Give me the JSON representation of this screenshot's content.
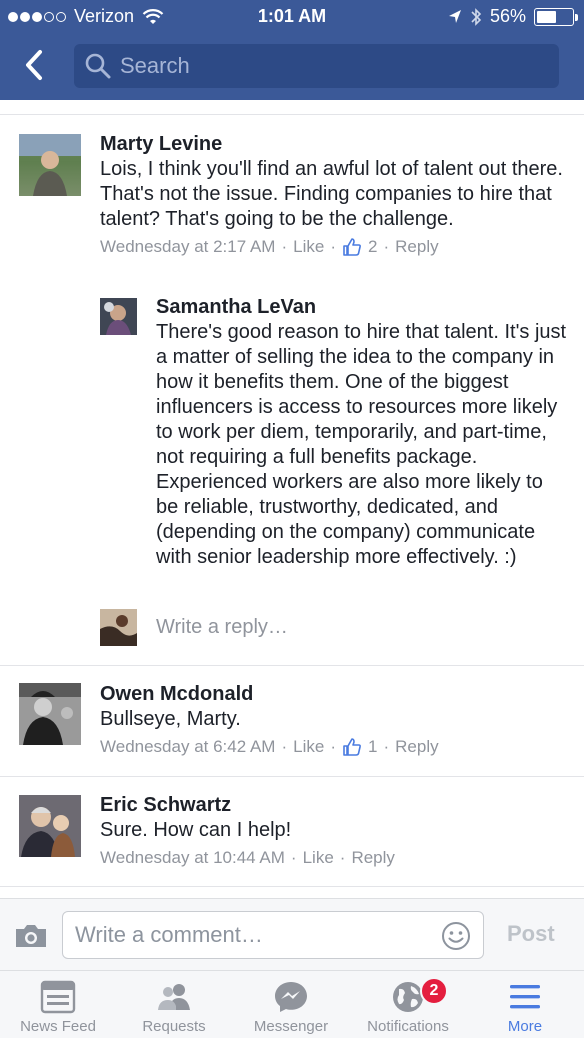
{
  "status_bar": {
    "carrier": "Verizon",
    "time": "1:01 AM",
    "battery": "56%",
    "battery_level": 0.56
  },
  "nav": {
    "search_placeholder": "Search"
  },
  "colors": {
    "brand": "#3b5998",
    "link": "#4a7be0",
    "meta": "#90949c",
    "badge": "#e41e3f"
  },
  "comments": [
    {
      "author": "Marty Levine",
      "text": "Lois, I think you'll find an awful lot of talent out there. That's not the issue. Finding companies to hire that talent? That's going to be the challenge.",
      "time": "Wednesday at 2:17 AM",
      "like_label": "Like",
      "like_count": "2",
      "reply_label": "Reply"
    },
    {
      "author": "Owen Mcdonald",
      "text": "Bullseye, Marty.",
      "time": "Wednesday at 6:42 AM",
      "like_label": "Like",
      "like_count": "1",
      "reply_label": "Reply"
    },
    {
      "author": "Eric Schwartz",
      "text": "Sure. How can I help!",
      "time": "Wednesday at 10:44 AM",
      "like_label": "Like",
      "reply_label": "Reply"
    }
  ],
  "reply": {
    "author": "Samantha LeVan",
    "text": "There's good reason to hire that talent. It's just a matter of selling the idea to the company in how it benefits them. One of the biggest influencers is access to resources more likely to work per diem, temporarily, and part-time, not requiring a full benefits package. Experienced workers are also more likely to be reliable, trustworthy, dedicated, and (depending on the company) communicate with senior leadership more effectively. :)"
  },
  "write_reply_placeholder": "Write a reply…",
  "composer": {
    "placeholder": "Write a comment…",
    "post_label": "Post"
  },
  "tabs": [
    {
      "label": "News Feed",
      "icon": "news-feed-icon"
    },
    {
      "label": "Requests",
      "icon": "friend-requests-icon"
    },
    {
      "label": "Messenger",
      "icon": "messenger-icon"
    },
    {
      "label": "Notifications",
      "icon": "globe-icon",
      "badge": "2"
    },
    {
      "label": "More",
      "icon": "menu-icon",
      "active": true
    }
  ]
}
